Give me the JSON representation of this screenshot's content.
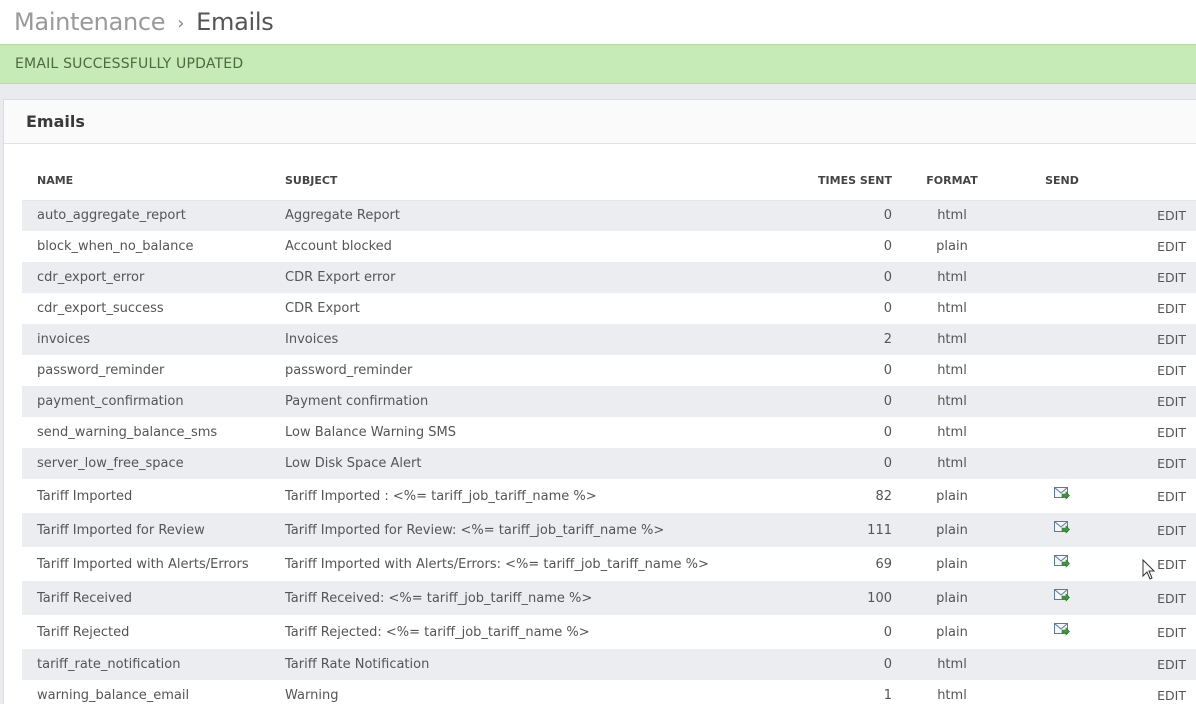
{
  "breadcrumb": {
    "parent": "Maintenance",
    "separator": "›",
    "current": "Emails"
  },
  "flash": {
    "message": "EMAIL SUCCESSFULLY UPDATED",
    "color": "#c6ebb6"
  },
  "panel": {
    "title": "Emails"
  },
  "table": {
    "headers": {
      "name": "NAME",
      "subject": "SUBJECT",
      "times_sent": "TIMES SENT",
      "format": "FORMAT",
      "send": "SEND"
    },
    "edit_label": "EDIT",
    "rows": [
      {
        "name": "auto_aggregate_report",
        "subject": "Aggregate Report",
        "times_sent": "0",
        "format": "html",
        "send": false
      },
      {
        "name": "block_when_no_balance",
        "subject": "Account blocked",
        "times_sent": "0",
        "format": "plain",
        "send": false
      },
      {
        "name": "cdr_export_error",
        "subject": "CDR Export error",
        "times_sent": "0",
        "format": "html",
        "send": false
      },
      {
        "name": "cdr_export_success",
        "subject": "CDR Export",
        "times_sent": "0",
        "format": "html",
        "send": false
      },
      {
        "name": "invoices",
        "subject": "Invoices",
        "times_sent": "2",
        "format": "html",
        "send": false
      },
      {
        "name": "password_reminder",
        "subject": "password_reminder",
        "times_sent": "0",
        "format": "html",
        "send": false
      },
      {
        "name": "payment_confirmation",
        "subject": "Payment confirmation",
        "times_sent": "0",
        "format": "html",
        "send": false
      },
      {
        "name": "send_warning_balance_sms",
        "subject": "Low Balance Warning SMS",
        "times_sent": "0",
        "format": "html",
        "send": false
      },
      {
        "name": "server_low_free_space",
        "subject": "Low Disk Space Alert",
        "times_sent": "0",
        "format": "html",
        "send": false
      },
      {
        "name": "Tariff Imported",
        "subject": "Tariff Imported : <%= tariff_job_tariff_name %>",
        "times_sent": "82",
        "format": "plain",
        "send": true
      },
      {
        "name": "Tariff Imported for Review",
        "subject": "Tariff Imported for Review: <%= tariff_job_tariff_name %>",
        "times_sent": "111",
        "format": "plain",
        "send": true
      },
      {
        "name": "Tariff Imported with Alerts/Errors",
        "subject": "Tariff Imported with Alerts/Errors: <%= tariff_job_tariff_name %>",
        "times_sent": "69",
        "format": "plain",
        "send": true
      },
      {
        "name": "Tariff Received",
        "subject": "Tariff Received: <%= tariff_job_tariff_name %>",
        "times_sent": "100",
        "format": "plain",
        "send": true
      },
      {
        "name": "Tariff Rejected",
        "subject": "Tariff Rejected: <%= tariff_job_tariff_name %>",
        "times_sent": "0",
        "format": "plain",
        "send": true
      },
      {
        "name": "tariff_rate_notification",
        "subject": "Tariff Rate Notification",
        "times_sent": "0",
        "format": "html",
        "send": false
      },
      {
        "name": "warning_balance_email",
        "subject": "Warning",
        "times_sent": "1",
        "format": "html",
        "send": false
      }
    ]
  },
  "icons": {
    "send": "send-email-icon",
    "cursor": "mouse-pointer-icon"
  }
}
